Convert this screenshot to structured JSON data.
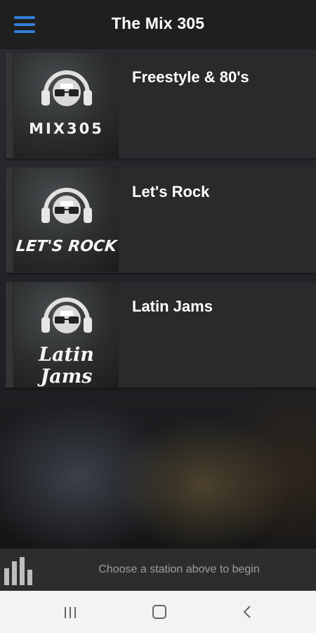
{
  "header": {
    "title": "The Mix 305",
    "menu_icon": "hamburger-menu-icon",
    "accent_color": "#2f7fd8"
  },
  "stations": [
    {
      "name": "Freestyle & 80's",
      "logo_text": "MIX305"
    },
    {
      "name": "Let's Rock",
      "logo_text": "LET'S ROCK"
    },
    {
      "name": "Latin Jams",
      "logo_text": "Latin Jams"
    }
  ],
  "player": {
    "status": "Choose a station above to begin",
    "icon": "equalizer-bars-icon"
  },
  "navbar": {
    "recents_icon": "recent-apps-icon",
    "home_icon": "home-icon",
    "back_icon": "back-icon"
  }
}
